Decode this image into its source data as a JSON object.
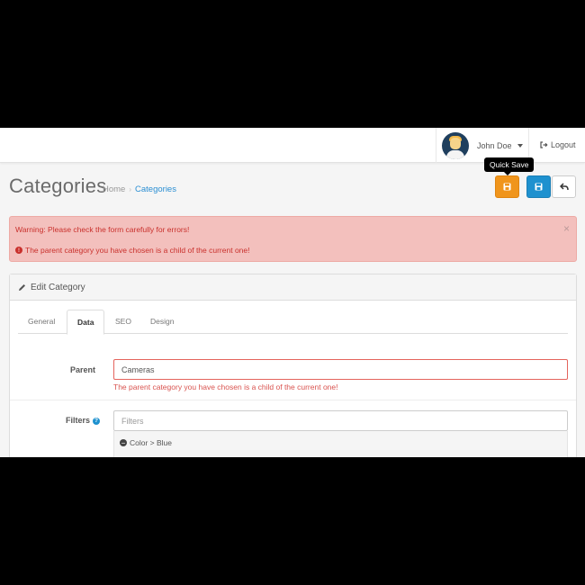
{
  "header": {
    "user_name": "John Doe",
    "logout_label": "Logout"
  },
  "page": {
    "title": "Categories",
    "breadcrumb": [
      "Home",
      "Categories"
    ],
    "breadcrumb_separator": "›"
  },
  "actions": {
    "quick_save_tooltip": "Quick Save",
    "quick_save_icon": "floppy-icon",
    "save_icon": "floppy-icon",
    "back_icon": "reply-icon"
  },
  "alert": {
    "warning": "Warning: Please check the form carefully for errors!",
    "error_icon": "!",
    "error": "The parent category you have chosen is a child of the current one!",
    "close": "×"
  },
  "panel": {
    "heading": "Edit Category",
    "tabs": [
      {
        "label": "General",
        "active": false
      },
      {
        "label": "Data",
        "active": true
      },
      {
        "label": "SEO",
        "active": false
      },
      {
        "label": "Design",
        "active": false
      }
    ]
  },
  "form": {
    "parent": {
      "label": "Parent",
      "value": "Cameras",
      "error": "The parent category you have chosen is a child of the current one!"
    },
    "filters": {
      "label": "Filters",
      "help_icon": "?",
      "placeholder": "Filters",
      "selected": [
        {
          "minus": "−",
          "label": "Color > Blue"
        }
      ]
    }
  },
  "colors": {
    "quick_save": "#f0951c",
    "save": "#1e91cf",
    "alert_bg": "#f3c0bd",
    "error_text": "#d9534f",
    "link": "#2b8fd3"
  }
}
